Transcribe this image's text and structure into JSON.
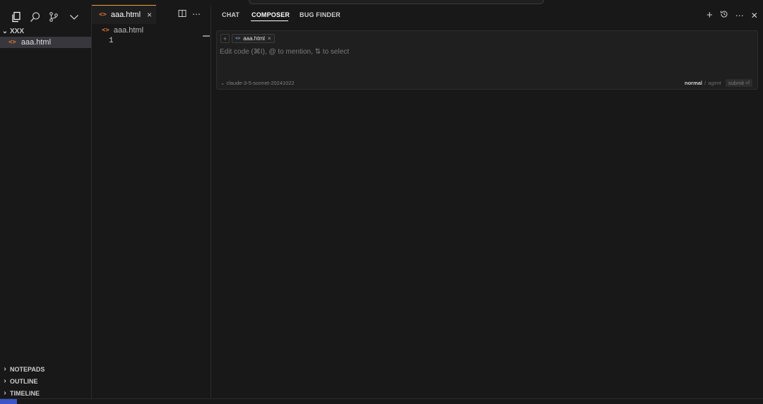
{
  "sidebar": {
    "activity_icons": [
      "explorer-icon",
      "search-icon",
      "source-control-icon",
      "chevron-down-icon"
    ],
    "root_folder": "XXX",
    "files": [
      {
        "name": "aaa.html",
        "icon": "html-icon"
      }
    ],
    "sections": [
      "NOTEPADS",
      "OUTLINE",
      "TIMELINE"
    ]
  },
  "editor": {
    "tab_label": "aaa.html",
    "tab_close": "×",
    "breadcrumb": "aaa.html",
    "line_number": "1"
  },
  "ai_pane": {
    "tabs": [
      "CHAT",
      "COMPOSER",
      "BUG FINDER"
    ],
    "active_tab": "COMPOSER",
    "context_chip": "aaa.html",
    "input_placeholder": "Edit code (⌘I), @ to mention, ⇅ to select",
    "model": "claude-3-5-sonnet-20241022",
    "mode_normal": "normal",
    "mode_sep": "/",
    "mode_agent": "agent",
    "submit_label": "submit ⏎"
  },
  "colors": {
    "background": "#181818",
    "accent_tab": "#e8a23f",
    "html_icon": "#e37933",
    "remote_indicator": "#3b55c9"
  }
}
